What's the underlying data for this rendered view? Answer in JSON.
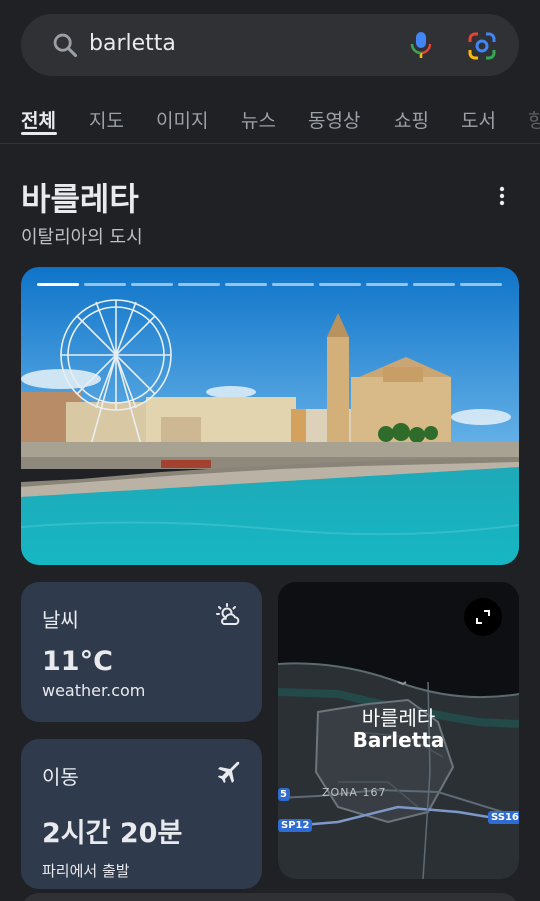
{
  "search": {
    "query": "barletta",
    "icons": [
      "search-icon",
      "mic-icon",
      "google-lens-icon"
    ]
  },
  "tabs": [
    {
      "label": "전체",
      "active": true
    },
    {
      "label": "지도"
    },
    {
      "label": "이미지"
    },
    {
      "label": "뉴스"
    },
    {
      "label": "동영상"
    },
    {
      "label": "쇼핑"
    },
    {
      "label": "도서"
    },
    {
      "label": "항"
    }
  ],
  "entity": {
    "title": "바를레타",
    "subtitle": "이탈리아의 도시"
  },
  "hero": {
    "slides_total": 10,
    "current_slide": 1
  },
  "weather": {
    "label": "날씨",
    "value": "11°C",
    "source": "weather.com",
    "icon": "partly-cloudy-icon"
  },
  "transit": {
    "label": "이동",
    "value": "2시간 20분",
    "source": "파리에서 출발",
    "icon": "airplane-icon"
  },
  "map": {
    "name_ko": "바를레타",
    "name_en": "Barletta",
    "zone": "ZONA 167",
    "roads": [
      "5",
      "SP12",
      "SS16"
    ]
  },
  "colors": {
    "background": "#202124",
    "card": "#303a4d",
    "search_bar": "#303134"
  }
}
